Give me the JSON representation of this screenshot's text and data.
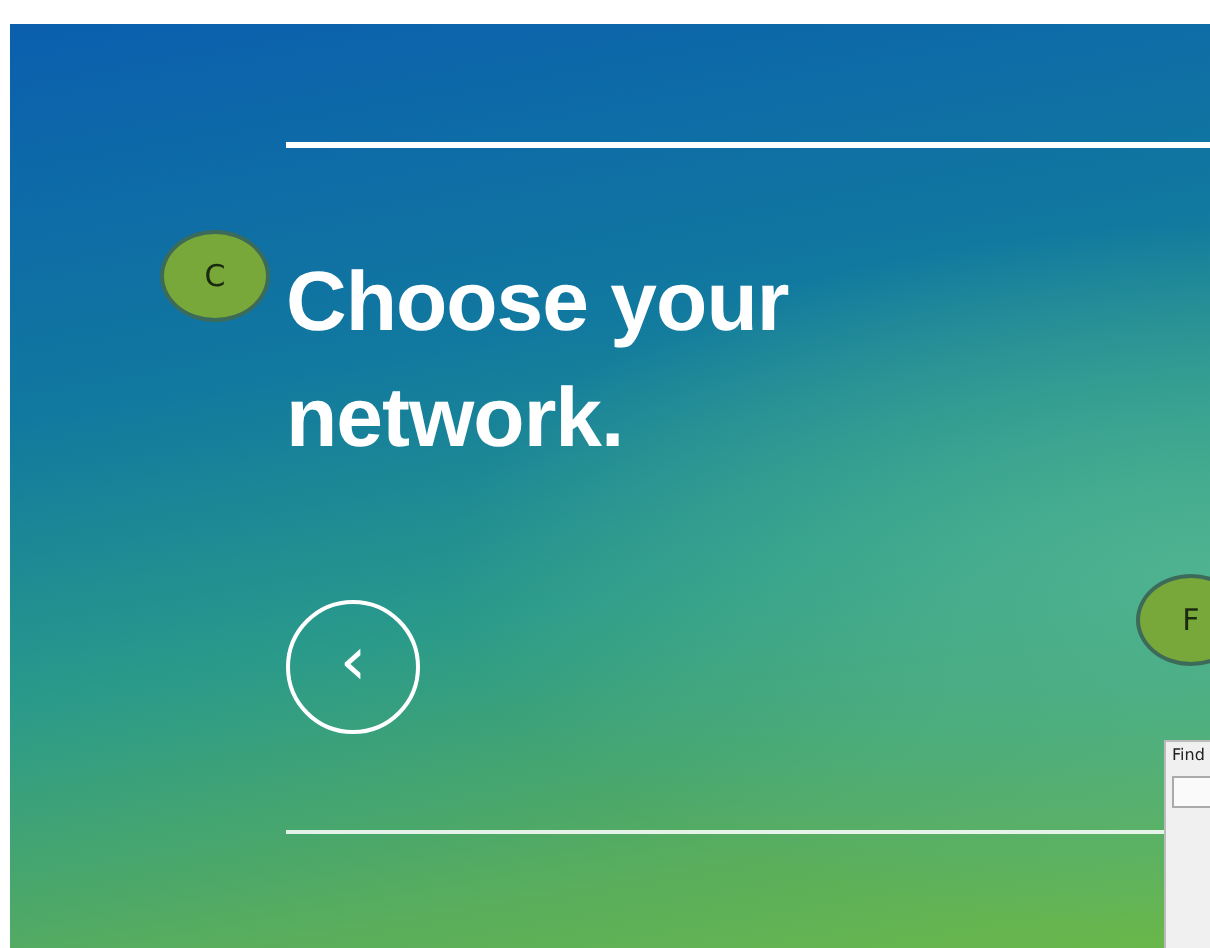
{
  "heading": "Choose your network.",
  "back_button": {
    "glyph": "‹"
  },
  "callouts": [
    {
      "label": "C"
    },
    {
      "label": "F"
    }
  ],
  "dialog": {
    "title": "Find"
  }
}
